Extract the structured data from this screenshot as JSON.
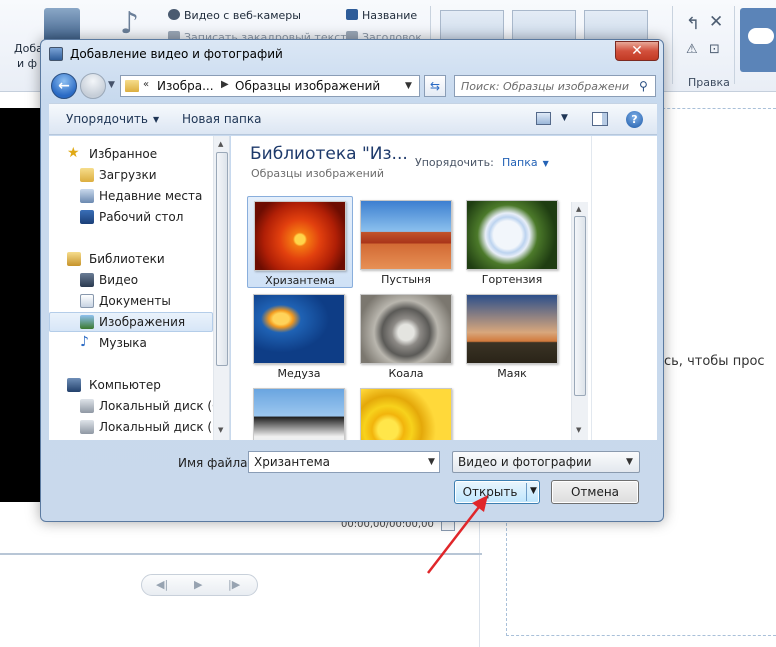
{
  "background_app": {
    "ribbon": {
      "add_label_line1": "Доба",
      "add_label_line2": "и ф",
      "webcam_video": "Видео с веб-камеры",
      "record_narration": "Записать закадровый текст",
      "title": "Название",
      "caption": "Заголовок",
      "edit_group": "Правка"
    },
    "timecode": "00:00,00/00:00,00",
    "storyboard_hint": "есь, чтобы прос",
    "play_controls": [
      "◀|",
      "▶",
      "|▶"
    ]
  },
  "dialog": {
    "title": "Добавление видео и фотографий",
    "close_glyph": "✕",
    "breadcrumb": [
      "Изобра...",
      "Образцы изображений"
    ],
    "search_placeholder": "Поиск: Образцы изображений",
    "toolbar": {
      "organize": "Упорядочить",
      "new_folder": "Новая папка"
    },
    "nav": {
      "favorites": "Избранное",
      "downloads": "Загрузки",
      "recent": "Недавние места",
      "desktop": "Рабочий стол",
      "libraries": "Библиотеки",
      "video": "Видео",
      "documents": "Документы",
      "pictures": "Изображения",
      "music": "Музыка",
      "computer": "Компьютер",
      "disk_c": "Локальный диск (C:)",
      "disk_d": "Локальный диск (D:)"
    },
    "library": {
      "title": "Библиотека \"Из...",
      "subtitle": "Образцы изображений",
      "arrange_label": "Упорядочить:",
      "arrange_value": "Папка"
    },
    "thumbnails": [
      {
        "label": "Хризантема",
        "selected": true
      },
      {
        "label": "Пустыня",
        "selected": false
      },
      {
        "label": "Гортензия",
        "selected": false
      },
      {
        "label": "Медуза",
        "selected": false
      },
      {
        "label": "Коала",
        "selected": false
      },
      {
        "label": "Маяк",
        "selected": false
      },
      {
        "label": "",
        "selected": false
      },
      {
        "label": "",
        "selected": false
      }
    ],
    "filename_label": "Имя файла:",
    "filename_value": "Хризантема",
    "filter_value": "Видео и фотографии",
    "open_button": "Открыть",
    "cancel_button": "Отмена"
  },
  "colors": {
    "accent": "#2563b6",
    "annotation_arrow": "#e0262a",
    "close_button": "#c23a24"
  }
}
